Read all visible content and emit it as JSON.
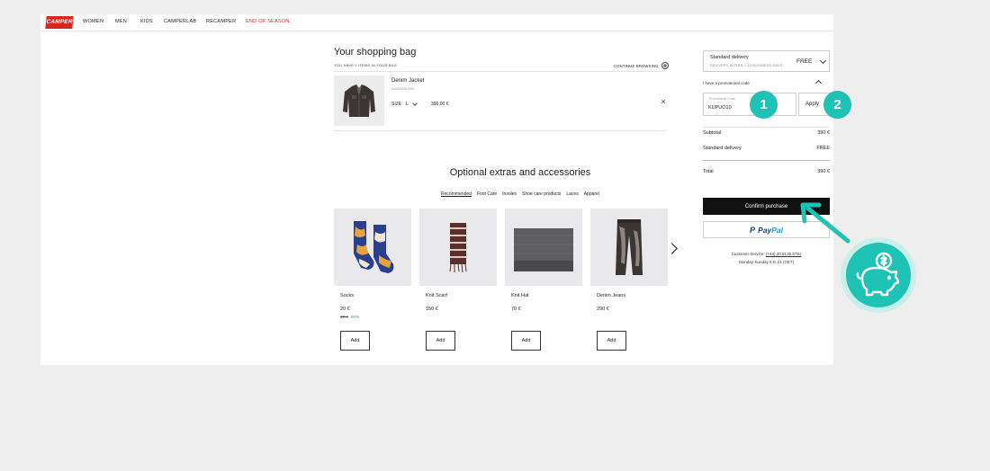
{
  "nav": {
    "logo": "CAMPER",
    "items": [
      {
        "label": "WOMEN",
        "highlight": false
      },
      {
        "label": "MEN",
        "highlight": false
      },
      {
        "label": "KIDS",
        "highlight": false
      },
      {
        "label": "CAMPERLAB",
        "highlight": false
      },
      {
        "label": "RECAMPER",
        "highlight": false
      },
      {
        "label": "END OF SEASON",
        "highlight": true
      }
    ]
  },
  "bag": {
    "title": "Your shopping bag",
    "subtitle": "YOU HAVE 1 ITEMS IN YOUR BAG",
    "continue_label": "CONTINUE BROWSING",
    "item": {
      "name": "Denim Jacket",
      "ref": "AU00008-005",
      "size_label": "SIZE",
      "size_value": "L",
      "price": "390,00 €",
      "remove_symbol": "×"
    }
  },
  "extras": {
    "title": "Optional extras and accessories",
    "tabs": [
      {
        "label": "Recommended",
        "active": true
      },
      {
        "label": "Foot Care",
        "active": false
      },
      {
        "label": "Insoles",
        "active": false
      },
      {
        "label": "Shoe care products",
        "active": false
      },
      {
        "label": "Laces",
        "active": false
      },
      {
        "label": "Apparel",
        "active": false
      }
    ],
    "products": [
      {
        "name": "Socks",
        "price": "20 €",
        "old_price": "40 €",
        "discount": "50%",
        "add_label": "Add",
        "icon": "socks-icon"
      },
      {
        "name": "Knit Scarf",
        "price": "150 €",
        "old_price": "",
        "discount": "",
        "add_label": "Add",
        "icon": "scarf-icon"
      },
      {
        "name": "Knit Hat",
        "price": "70 €",
        "old_price": "",
        "discount": "",
        "add_label": "Add",
        "icon": "hat-icon"
      },
      {
        "name": "Denim Jeans",
        "price": "290 €",
        "old_price": "",
        "discount": "",
        "add_label": "Add",
        "icon": "jeans-icon"
      }
    ]
  },
  "summary": {
    "delivery_title": "Standard delivery",
    "delivery_sub": "DELIVERY WITHIN 7-10 BUSINESS DAYS",
    "delivery_price": "FREE",
    "promo_label": "I have a promotional code",
    "promo_input_label": "Promotional Code",
    "promo_input_value": "KUPUO10",
    "apply_label": "Apply",
    "subtotal_label": "Subtotal",
    "subtotal_value": "390 €",
    "std_delivery_label": "Standard delivery",
    "std_delivery_value": "FREE",
    "total_label": "Total",
    "total_value": "390 €",
    "confirm_label": "Confirm purchase",
    "paypal_p": "P",
    "paypal_pay": "Pay",
    "paypal_pal": "Pal",
    "cs_prefix": "Customer Service: ",
    "cs_phone": "(+44) 20 8135 6791",
    "cs_hours": "Monday-Sunday 9 to 21 (CET)"
  },
  "overlay": {
    "step1": "1",
    "step2": "2",
    "accent": "#1ec3b6"
  }
}
